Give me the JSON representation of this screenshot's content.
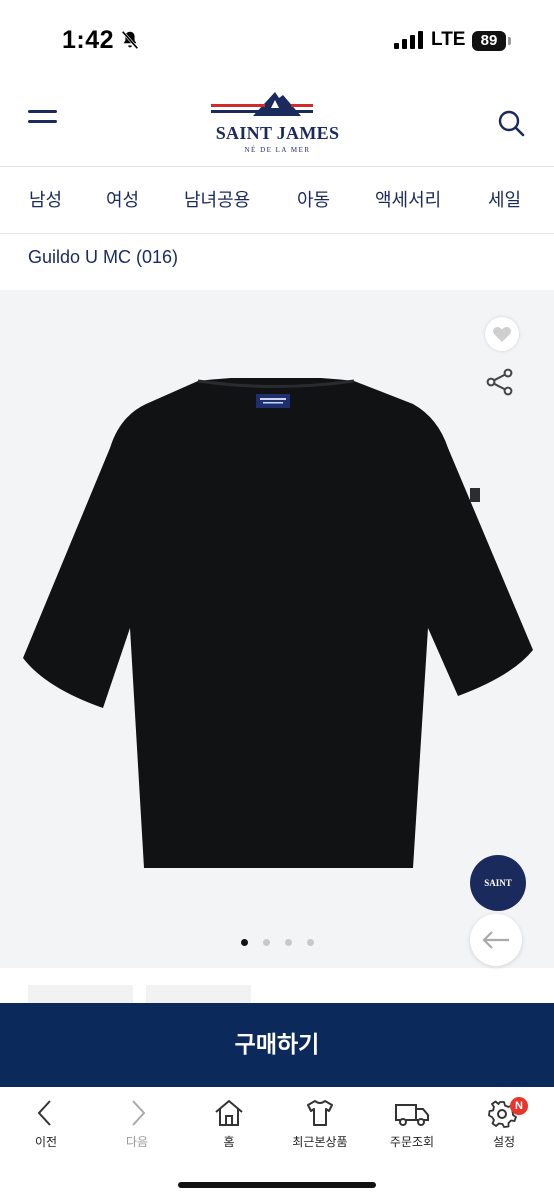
{
  "status_bar": {
    "time": "1:42",
    "network": "LTE",
    "battery": "89"
  },
  "header": {
    "brand": "SAINT JAMES",
    "brand_tagline": "NÉ DE LA MER",
    "menu_icon": "hamburger-icon",
    "search_icon": "search-icon"
  },
  "categories": [
    "남성",
    "여성",
    "남녀공용",
    "아동",
    "액세서리",
    "세일"
  ],
  "product": {
    "name": "Guildo U MC (016)"
  },
  "gallery": {
    "slide_count": 4,
    "active_slide": 1,
    "badge_text": "SAINT JAMES"
  },
  "buy_button": {
    "label": "구매하기"
  },
  "tabbar": [
    {
      "label": "이전",
      "icon": "chevron-left-icon"
    },
    {
      "label": "다음",
      "icon": "chevron-right-icon"
    },
    {
      "label": "홈",
      "icon": "home-icon"
    },
    {
      "label": "최근본상품",
      "icon": "tshirt-icon"
    },
    {
      "label": "주문조회",
      "icon": "truck-icon"
    },
    {
      "label": "설정",
      "icon": "gear-icon",
      "badge": "N"
    }
  ],
  "colors": {
    "navy": "#0b2a5b",
    "brand_red": "#d12c2c"
  }
}
